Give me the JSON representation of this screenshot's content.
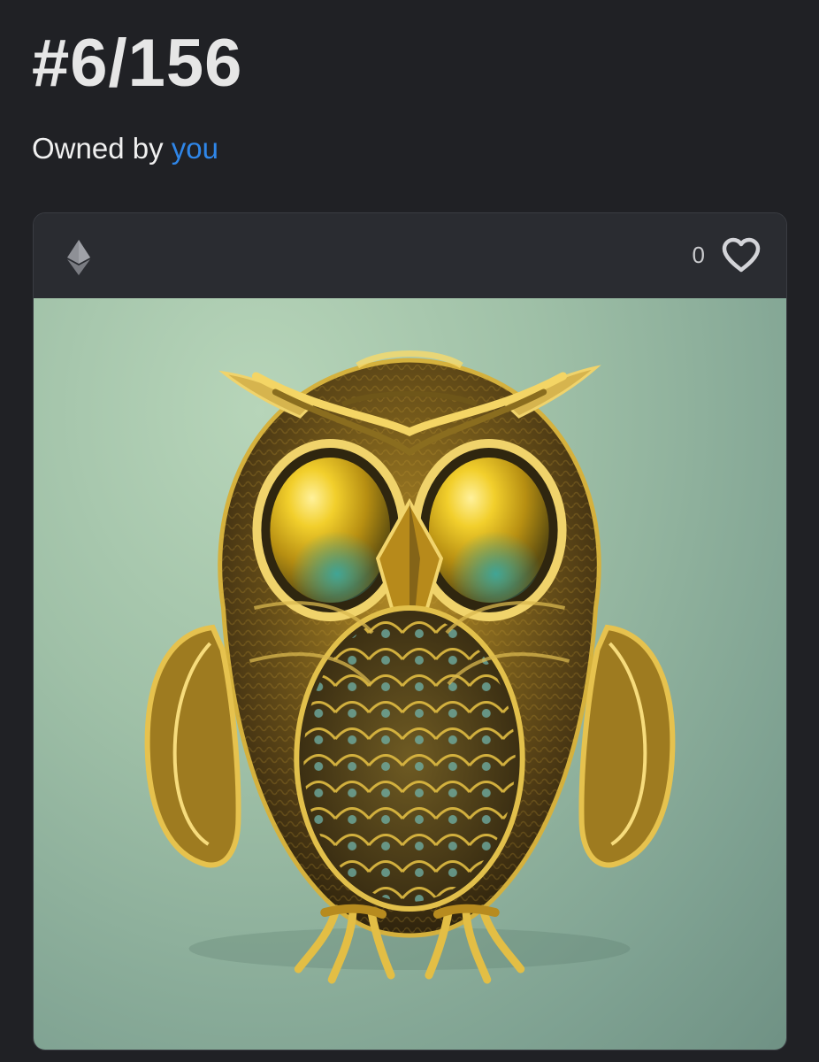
{
  "page": {
    "title_partial": "",
    "title": "#6/156",
    "owned_by_prefix": "Owned by",
    "owner": "you"
  },
  "card": {
    "currency_icon": "ethereum-icon",
    "like_count": "0",
    "like_icon": "heart-outline-icon",
    "image_subject": "golden-owl-artwork"
  },
  "colors": {
    "background": "#202125",
    "card": "#2a2c31",
    "link": "#2f86e8",
    "text": "#e6e6e6"
  }
}
